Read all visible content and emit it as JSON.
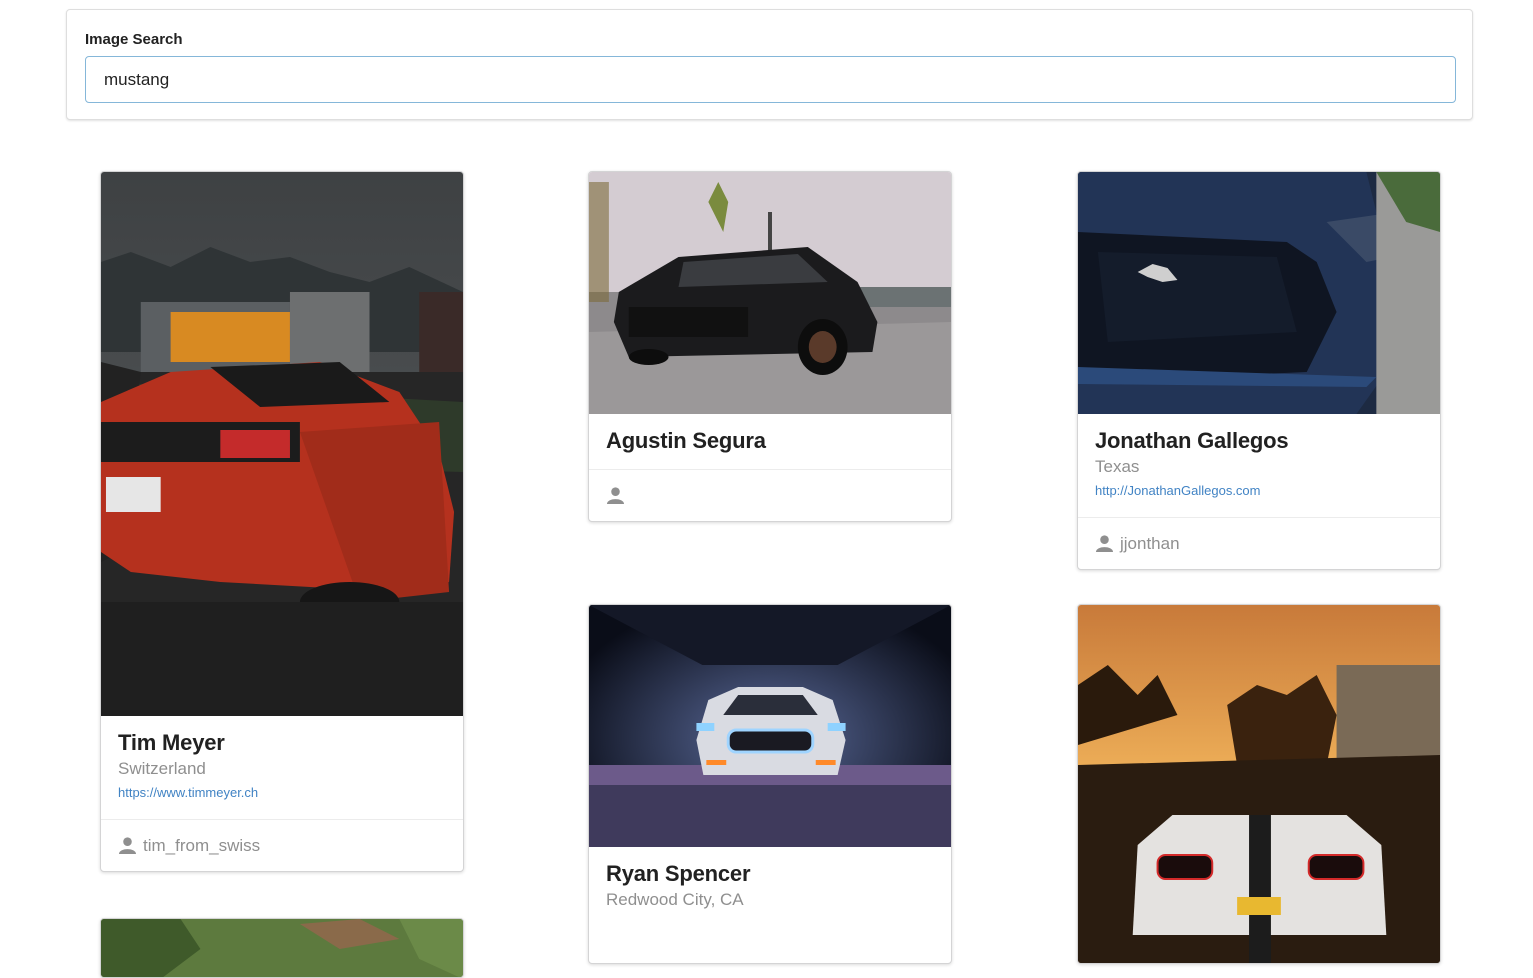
{
  "search": {
    "label": "Image Search",
    "value": "mustang"
  },
  "cards": [
    {
      "name": "Tim Meyer",
      "location": "Switzerland",
      "link": "https://www.timmeyer.ch",
      "username": "tim_from_swiss"
    },
    {
      "name": "Agustin Segura",
      "username": ""
    },
    {
      "name": "Jonathan Gallegos",
      "location": "Texas",
      "link": "http://JonathanGallegos.com",
      "username": "jjonthan"
    },
    {
      "name": "Ryan Spencer",
      "location": "Redwood City, CA"
    }
  ],
  "icons": {
    "user": "user-icon"
  }
}
